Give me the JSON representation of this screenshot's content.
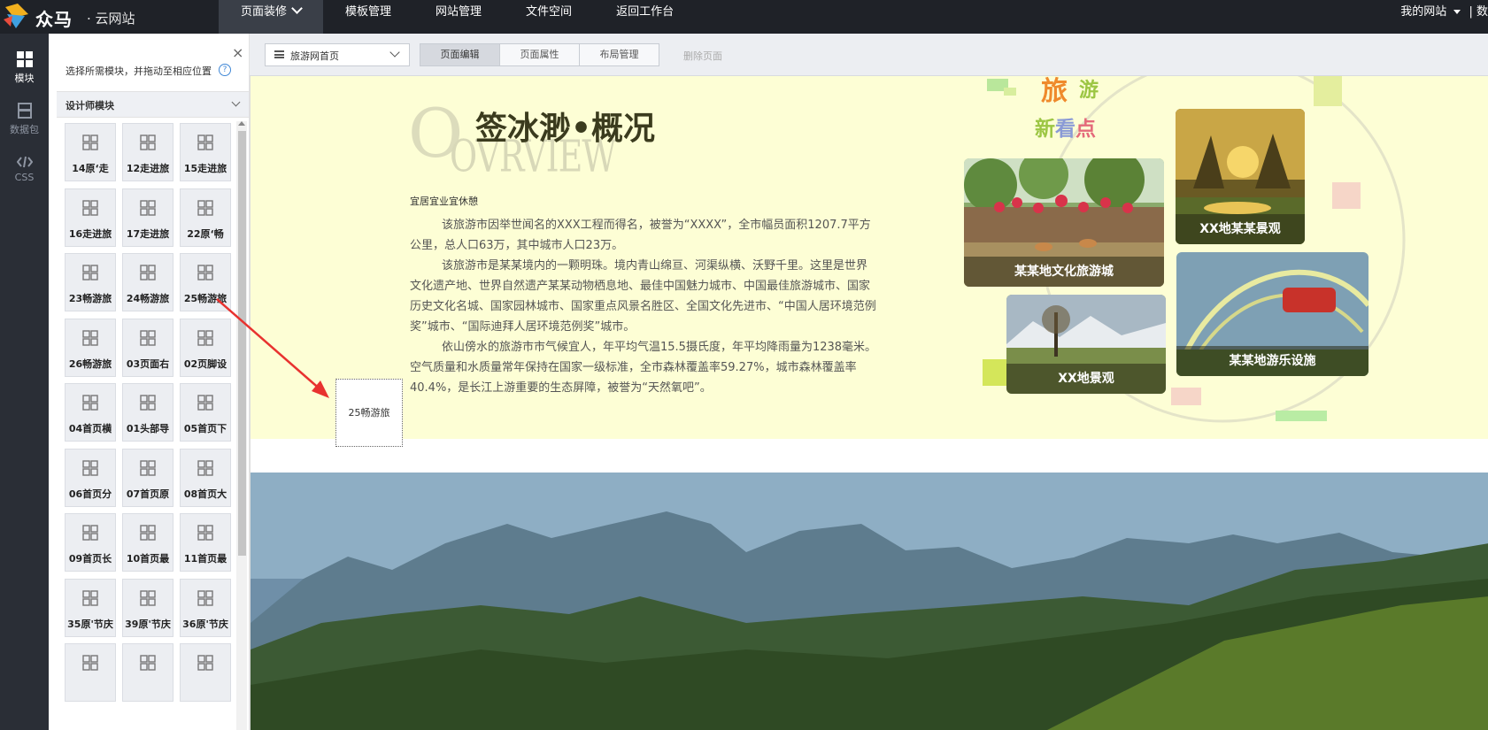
{
  "topbar": {
    "brand": "众马",
    "subbrand": "· 云网站",
    "nav": [
      {
        "label": "页面装修",
        "active": true
      },
      {
        "label": "模板管理",
        "active": false
      },
      {
        "label": "网站管理",
        "active": false
      },
      {
        "label": "文件空间",
        "active": false
      },
      {
        "label": "返回工作台",
        "active": false
      }
    ],
    "right_label": "我的网站",
    "right_cut": "| 数"
  },
  "leftbar": {
    "items": [
      {
        "label": "模块",
        "icon": "modules-grid-icon",
        "active": true
      },
      {
        "label": "数据包",
        "icon": "data-package-icon",
        "active": false
      },
      {
        "label": "CSS",
        "icon": "code-icon",
        "active": false
      }
    ]
  },
  "panel": {
    "hint": "选择所需模块，并拖动至相应位置",
    "help": "?",
    "close": "×",
    "section_title": "设计师模块",
    "tiles": [
      "14原‘走",
      "12走进旅",
      "15走进旅",
      "16走进旅",
      "17走进旅",
      "22原‘畅",
      "23畅游旅",
      "24畅游旅",
      "25畅游旅",
      "26畅游旅",
      "03页面右",
      "02页脚设",
      "04首页横",
      "01头部导",
      "05首页下",
      "06首页分",
      "07首页原",
      "08首页大",
      "09首页长",
      "10首页最",
      "11首页最",
      "35原'节庆",
      "39原'节庆",
      "36原'节庆",
      "",
      "",
      ""
    ]
  },
  "toolbar": {
    "page_select": "旅游网首页",
    "tabs": [
      {
        "label": "页面编辑",
        "active": true
      },
      {
        "label": "页面属性",
        "active": false
      },
      {
        "label": "布局管理",
        "active": false
      }
    ],
    "delete_label": "删除页面"
  },
  "content": {
    "overview_letter": "O",
    "overview_word": "OVRVIEW",
    "title": "签冰渺•概况",
    "subtitle": "宜居宜业宜休憩",
    "paragraphs": [
      "该旅游市因举世闻名的XXX工程而得名，被誉为“XXXX”，全市幅员面积1207.7平方公里，总人口63万，其中城市人口23万。",
      "该旅游市是某某境内的一颗明珠。境内青山绵亘、河渠纵横、沃野千里。这里是世界文化遗产地、世界自然遗产某某动物栖息地、最佳中国魅力城市、中国最佳旅游城市、国家历史文化名城、国家园林城市、国家重点风景名胜区、全国文化先进市、“中国人居环境范例奖”城市、“国际迪拜人居环境范例奖”城市。",
      "依山傍水的旅游市市气候宜人，年平均气温15.5摄氏度，年平均降雨量为1238毫米。空气质量和水质量常年保持在国家一级标准，全市森林覆盖率59.27%，城市森林覆盖率40.4%，是长江上游重要的生态屏障，被誉为“天然氧吧”。"
    ],
    "deco": {
      "w1": "旅",
      "w2": "游",
      "w3": [
        "新",
        "看",
        "点"
      ]
    },
    "cards": [
      "某某地文化旅游城",
      "XX地某某景观",
      "XX地景观",
      "某某地游乐设施"
    ]
  },
  "drag_ghost": "25畅游旅"
}
